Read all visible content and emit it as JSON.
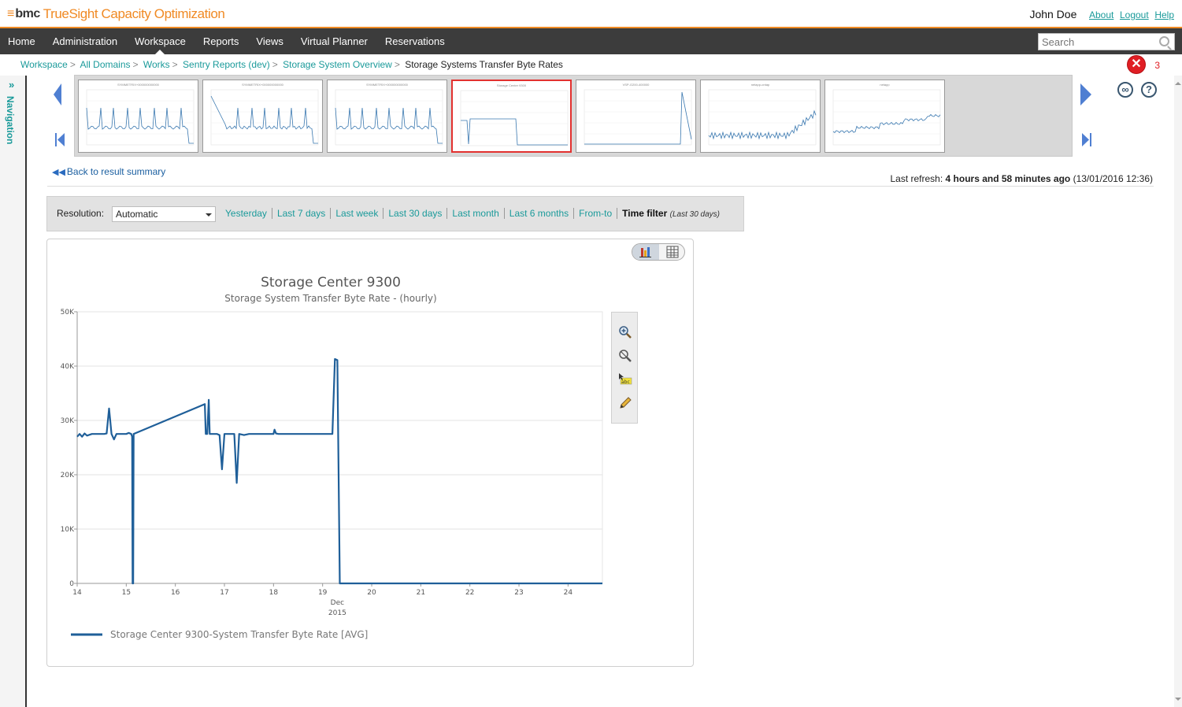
{
  "header": {
    "brand": "bmc",
    "product": "TrueSight Capacity Optimization",
    "user": "John Doe",
    "links": [
      "About",
      "Logout",
      "Help"
    ]
  },
  "topnav": {
    "items": [
      "Home",
      "Administration",
      "Workspace",
      "Reports",
      "Views",
      "Virtual Planner",
      "Reservations"
    ],
    "active": "Workspace",
    "search_placeholder": "Search"
  },
  "breadcrumb": {
    "crumbs": [
      "Workspace",
      "All Domains",
      "Works",
      "Sentry Reports (dev)",
      "Storage System Overview"
    ],
    "current": "Storage Systems Transfer Byte Rates"
  },
  "errors": {
    "count": "3"
  },
  "leftnav": {
    "label": "Navigation"
  },
  "thumbnails": [
    {
      "title": "SYMMETRIX+000000000000"
    },
    {
      "title": "SYMMETRIX+000000000000"
    },
    {
      "title": "SYMMETRIX+000000000000"
    },
    {
      "title": "Storage Center 9300"
    },
    {
      "title": "VSP-G200-400000"
    },
    {
      "title": "netapp-ontap"
    },
    {
      "title": "netapp"
    }
  ],
  "selected_thumbnail": 3,
  "back_link": "Back to result summary",
  "refresh": {
    "prefix": "Last refresh:",
    "ago": "4 hours and 58 minutes ago",
    "timestamp": "(13/01/2016 12:36)"
  },
  "resolution": {
    "label": "Resolution:",
    "value": "Automatic",
    "options": [
      "Yesterday",
      "Last 7 days",
      "Last week",
      "Last 30 days",
      "Last month",
      "Last 6 months",
      "From-to"
    ],
    "time_filter": "Time filter",
    "time_filter_note": "(Last 30 days)"
  },
  "chart_data": {
    "type": "line",
    "title": "Storage Center 9300",
    "subtitle": "Storage System Transfer Byte Rate - (hourly)",
    "xlabel": "Dec",
    "xlabel2": "2015",
    "ylim": [
      0,
      50000
    ],
    "yticks": [
      "0",
      "10K",
      "20K",
      "30K",
      "40K",
      "50K"
    ],
    "xlim": [
      14,
      24.7
    ],
    "xticks": [
      14,
      15,
      16,
      17,
      18,
      19,
      20,
      21,
      22,
      23,
      24
    ],
    "grid": true,
    "legend_position": "bottom-left",
    "series": [
      {
        "name": "Storage Center 9300-System Transfer Byte Rate [AVG]",
        "color": "#1f5f99",
        "x": [
          14.0,
          14.05,
          14.1,
          14.15,
          14.2,
          14.3,
          14.4,
          14.5,
          14.55,
          14.6,
          14.65,
          14.7,
          14.75,
          14.8,
          14.9,
          15.0,
          15.05,
          15.1,
          15.12,
          15.13,
          15.14,
          15.15,
          15.2,
          16.6,
          16.62,
          16.65,
          16.68,
          16.7,
          16.72,
          16.75,
          16.8,
          16.85,
          16.9,
          16.95,
          17.0,
          17.1,
          17.2,
          17.25,
          17.3,
          17.4,
          17.5,
          17.6,
          17.8,
          18.0,
          18.02,
          18.05,
          18.1,
          18.2,
          18.4,
          18.6,
          18.8,
          19.0,
          19.1,
          19.2,
          19.25,
          19.3,
          19.35,
          19.4,
          19.6,
          20.0,
          21.0,
          22.0,
          23.0,
          24.0,
          24.7
        ],
        "y": [
          27000,
          27500,
          27000,
          27600,
          27200,
          27500,
          27500,
          27500,
          27500,
          27600,
          32200,
          27500,
          26500,
          27500,
          27500,
          27500,
          27700,
          27500,
          27000,
          0,
          0,
          27500,
          27700,
          33000,
          27500,
          27500,
          33800,
          27500,
          27500,
          27500,
          27500,
          27500,
          27300,
          21000,
          27500,
          27500,
          27500,
          18500,
          27500,
          27300,
          27500,
          27500,
          27500,
          27500,
          28300,
          27600,
          27500,
          27500,
          27500,
          27500,
          27500,
          27500,
          27500,
          27500,
          41300,
          41100,
          0,
          0,
          0,
          0,
          0,
          0,
          0,
          0,
          0
        ]
      }
    ]
  },
  "chart_tools": [
    "zoom-in-icon",
    "zoom-reset-icon",
    "annotate-icon",
    "edit-icon"
  ],
  "colors": {
    "accent": "#f08a24",
    "link": "#1a9a9a",
    "nav_bg": "#3c3c3c",
    "selected_border": "#e2312f"
  }
}
